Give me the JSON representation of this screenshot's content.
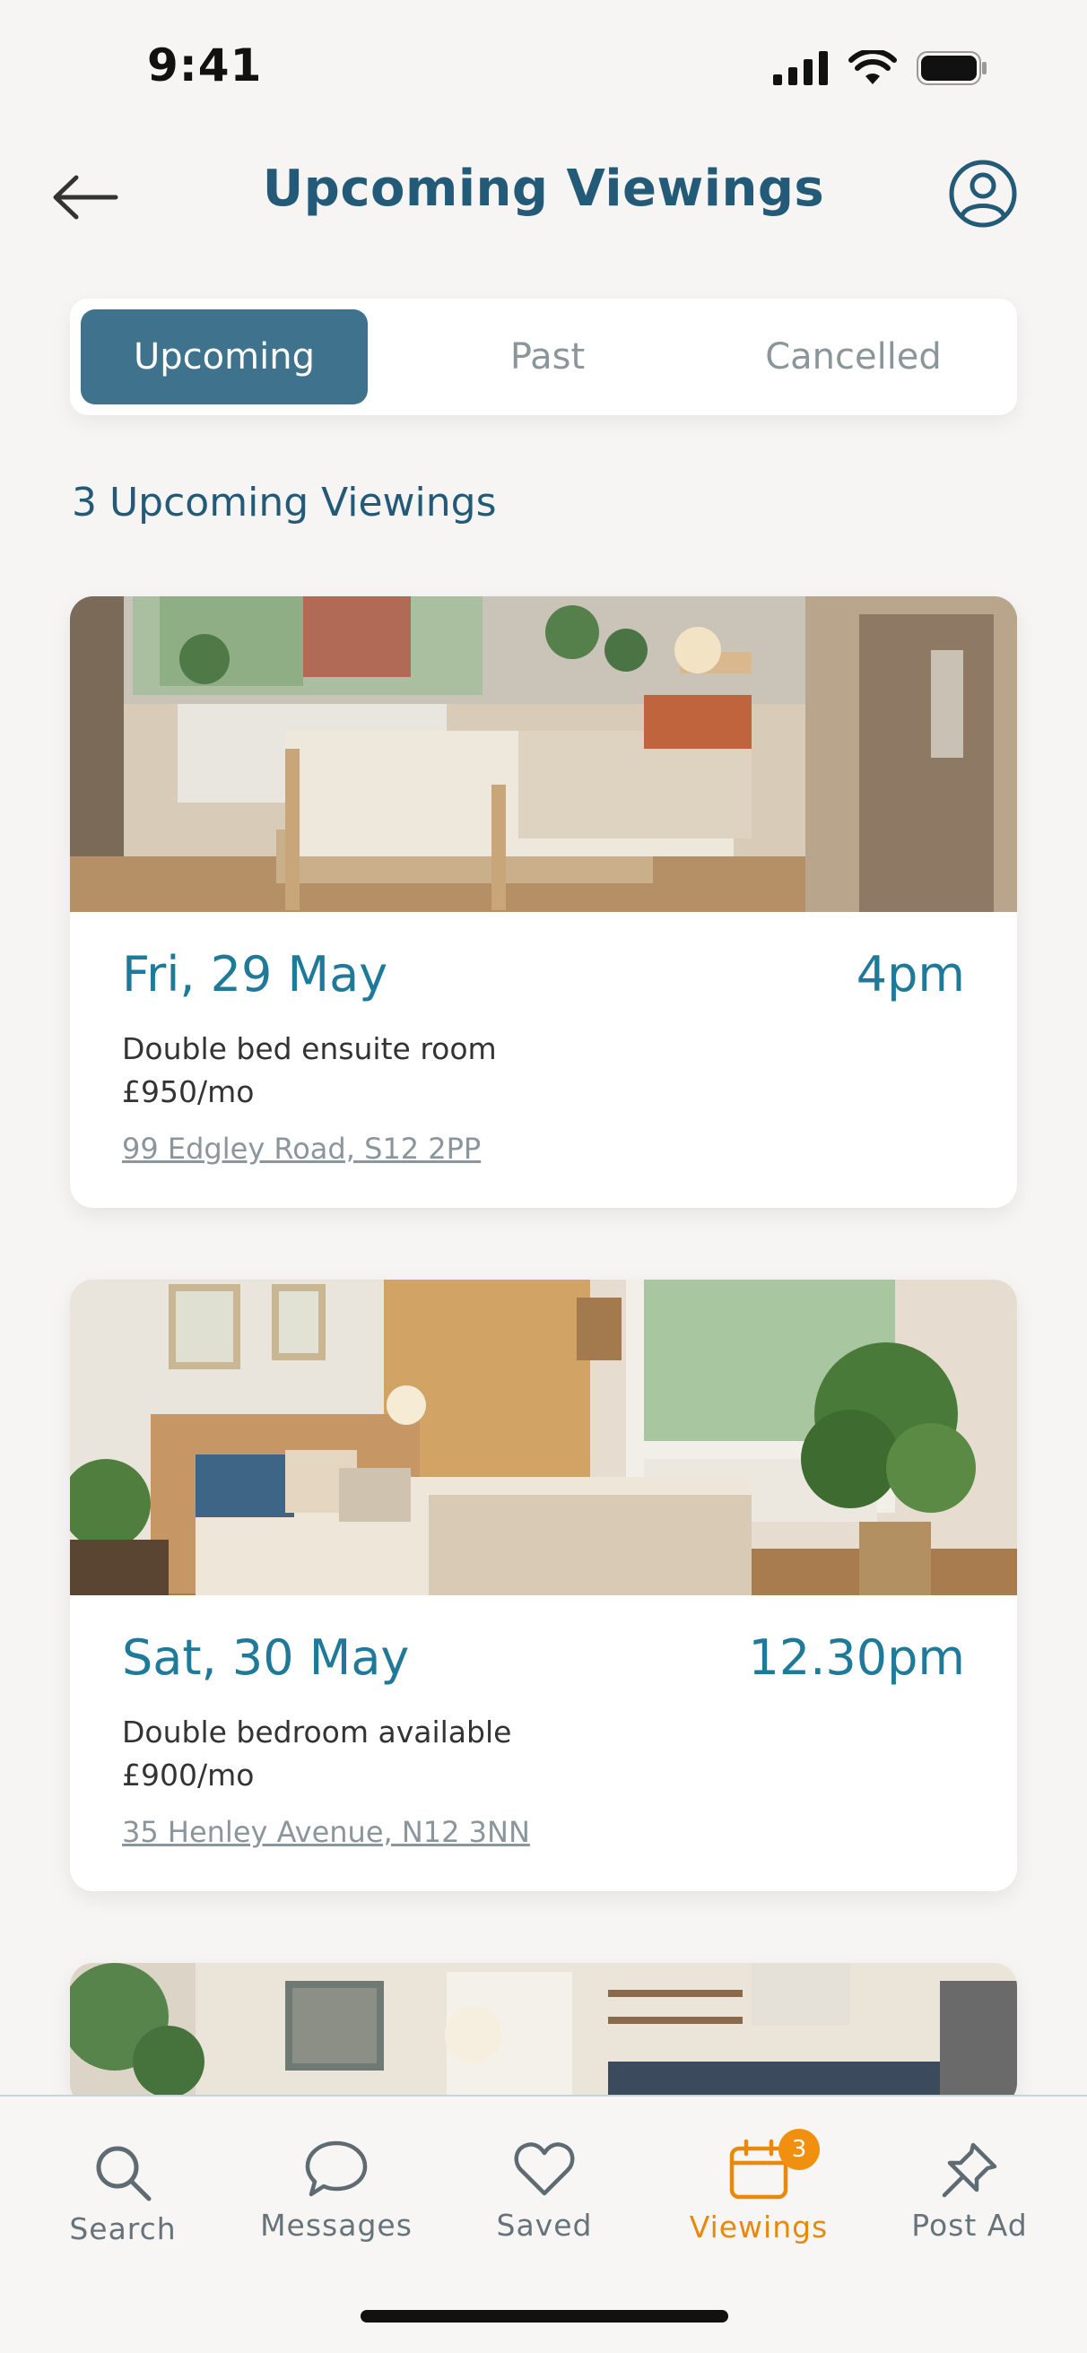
{
  "status": {
    "time": "9:41"
  },
  "header": {
    "title": "Upcoming Viewings"
  },
  "tabs": [
    {
      "label": "Upcoming",
      "active": true
    },
    {
      "label": "Past",
      "active": false
    },
    {
      "label": "Cancelled",
      "active": false
    }
  ],
  "summary": {
    "count_label": "3 Upcoming Viewings"
  },
  "viewings": [
    {
      "date": "Fri, 29 May",
      "time": "4pm",
      "title": "Double bed ensuite room",
      "price": "£950/mo",
      "address": "99 Edgley Road, S12 2PP",
      "image_icon": "bedroom-photo"
    },
    {
      "date": "Sat, 30 May",
      "time": "12.30pm",
      "title": "Double bedroom available",
      "price": "£900/mo",
      "address": "35 Henley Avenue, N12 3NN",
      "image_icon": "bedroom-photo"
    }
  ],
  "nav": {
    "items": [
      {
        "label": "Search",
        "icon": "search-icon"
      },
      {
        "label": "Messages",
        "icon": "message-icon"
      },
      {
        "label": "Saved",
        "icon": "heart-icon"
      },
      {
        "label": "Viewings",
        "icon": "calendar-icon",
        "badge": "3",
        "active": true
      },
      {
        "label": "Post Ad",
        "icon": "pin-icon"
      }
    ]
  },
  "colors": {
    "primary": "#235a78",
    "accent": "#1f7a9a",
    "active_tab": "#3e728d",
    "nav_active": "#e8890c",
    "badge": "#f0900e"
  }
}
